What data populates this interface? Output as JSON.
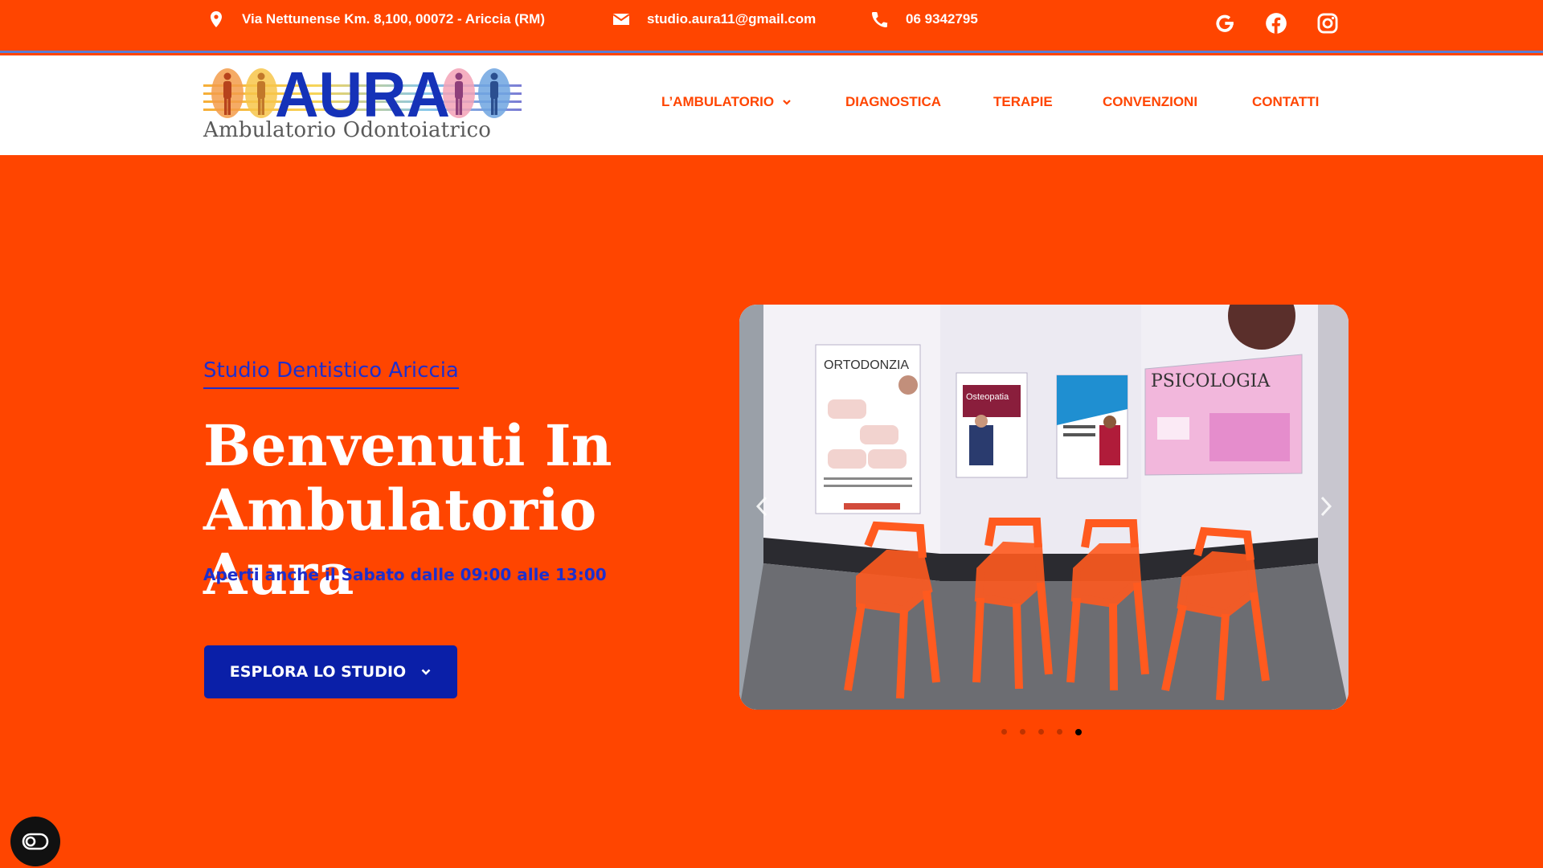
{
  "topbar": {
    "address": "Via Nettunense Km. 8,100, 00072 - Ariccia (RM)",
    "email": "studio.aura11@gmail.com",
    "phone": "06 9342795",
    "socials": [
      "google-icon",
      "facebook-icon",
      "instagram-icon"
    ],
    "color": "#FF4500"
  },
  "logo": {
    "wordmark": "AURA",
    "subtitle": "Ambulatorio Odontoiatrico"
  },
  "nav": {
    "items": [
      {
        "label": "L’AMBULATORIO",
        "has_dropdown": true
      },
      {
        "label": "DIAGNOSTICA"
      },
      {
        "label": "TERAPIE"
      },
      {
        "label": "CONVENZIONI"
      },
      {
        "label": "CONTATTI"
      }
    ],
    "color": "#FF4500"
  },
  "hero": {
    "eyebrow": "Studio Dentistico Ariccia",
    "title": "Benvenuti In Ambulatorio Aura",
    "subtitle": "Aperti anche il Sabato dalle 09:00 alle 13:00",
    "cta_label": "ESPLORA LO STUDIO",
    "cta_color": "#0A1FA8",
    "accent_color": "#1E2FCC"
  },
  "slider": {
    "poster_texts": [
      "ORTODONZIA",
      "Osteopatia",
      "PSICOLOGIA"
    ],
    "dot_count": 5,
    "active_dot": 5,
    "prev_icon": "chevron-left-icon",
    "next_icon": "chevron-right-icon"
  },
  "accessibility": {
    "icon": "accessibility-toggle-icon"
  }
}
